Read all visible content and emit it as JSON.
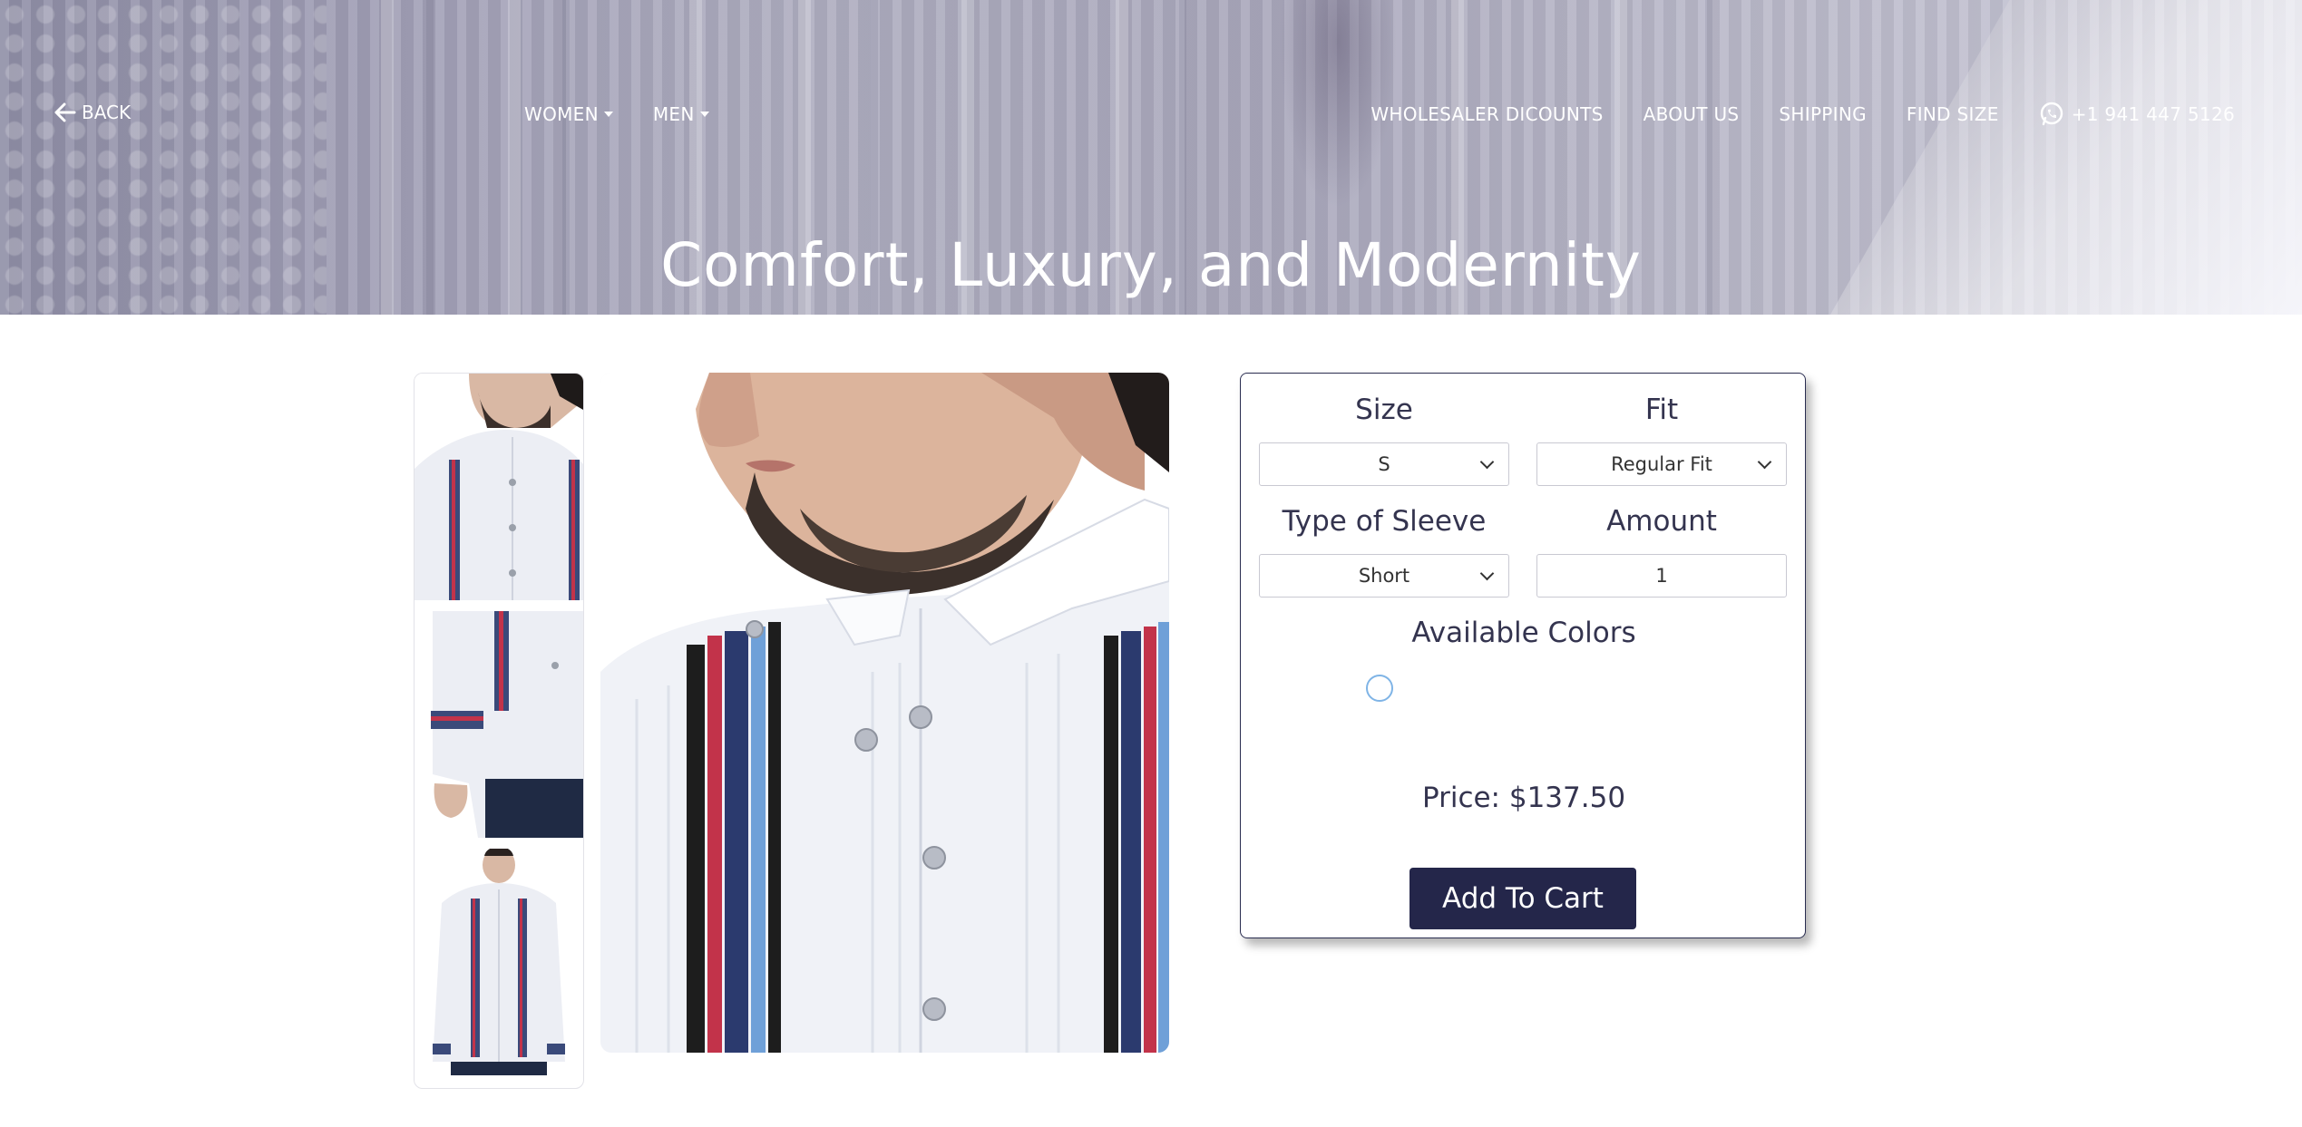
{
  "header": {
    "back_label": "BACK",
    "nav_left": [
      {
        "label": "WOMEN"
      },
      {
        "label": "MEN"
      }
    ],
    "nav_right": [
      {
        "label": "WHOLESALER DICOUNTS"
      },
      {
        "label": "ABOUT US"
      },
      {
        "label": "SHIPPING"
      },
      {
        "label": "FIND SIZE"
      }
    ],
    "phone": "+1 941 447 5126",
    "hero_title": "Comfort, Luxury, and Modernity"
  },
  "options": {
    "size": {
      "label": "Size",
      "value": "S"
    },
    "fit": {
      "label": "Fit",
      "value": "Regular Fit"
    },
    "sleeve": {
      "label": "Type of Sleeve",
      "value": "Short"
    },
    "amount": {
      "label": "Amount",
      "value": "1"
    },
    "colors_label": "Available Colors",
    "price_text": "Price: $137.50",
    "add_to_cart": "Add To Cart"
  },
  "colors": {
    "accent_dark": "#24264a",
    "swatch_ring": "#7fb4e6",
    "shirt": "#f3f4f8",
    "embroidery": [
      "#2b3a6e",
      "#c2334a",
      "#6fa0d8",
      "#1d1d1d"
    ]
  },
  "icons": [
    "arrow-left-icon",
    "whatsapp-icon",
    "caret-down-icon",
    "chevron-down-icon"
  ]
}
